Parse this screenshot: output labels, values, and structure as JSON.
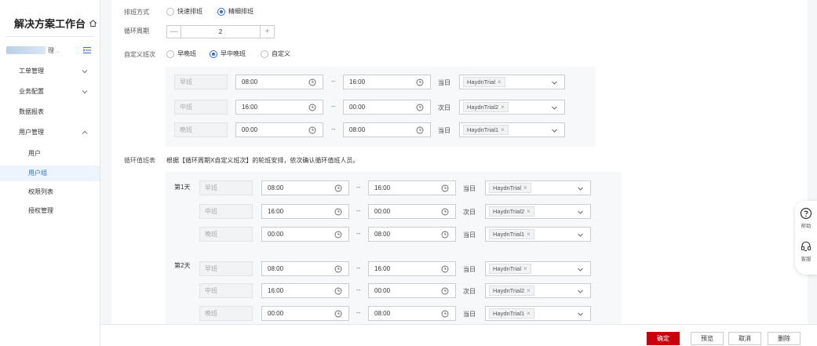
{
  "sidebar": {
    "title": "解决方案工作台",
    "user_text": "理",
    "user_dots": "..",
    "menus": [
      {
        "label": "工单管理",
        "state": "collapsed"
      },
      {
        "label": "业务配置",
        "state": "collapsed"
      },
      {
        "label": "数据报表"
      },
      {
        "label": "用户管理",
        "state": "expanded"
      }
    ],
    "submenu": [
      "用户",
      "用户组",
      "权限列表",
      "授权管理"
    ],
    "active": "用户组"
  },
  "form": {
    "schedule_mode": {
      "label": "排班方式",
      "options": [
        "快速排班",
        "精细排班"
      ],
      "selected": "精细排班"
    },
    "cycle_period": {
      "label": "循环周期",
      "value": "2",
      "minus": "—",
      "plus": "+"
    },
    "custom_shift": {
      "label": "自定义班次",
      "options": [
        "早晚班",
        "早中晚班",
        "自定义"
      ],
      "selected": "早中晚班"
    },
    "shifts": [
      {
        "name": "早班",
        "start": "08:00",
        "end": "16:00",
        "day": "当日",
        "person": "HaydnTrial"
      },
      {
        "name": "中班",
        "start": "16:00",
        "end": "00:00",
        "day": "次日",
        "person": "HaydnTrial2"
      },
      {
        "name": "晚班",
        "start": "00:00",
        "end": "08:00",
        "day": "当日",
        "person": "HaydnTrial1"
      }
    ],
    "separator": "--",
    "rotation_table": {
      "label": "循环值班表",
      "description": "根据【循环周期X自定义班次】的轮班安排，依次确认循环值班人员。",
      "days": [
        {
          "day_label": "第1天",
          "rows": [
            {
              "name": "早班",
              "start": "08:00",
              "end": "16:00",
              "day": "当日",
              "person": "HaydnTrial"
            },
            {
              "name": "中班",
              "start": "16:00",
              "end": "00:00",
              "day": "次日",
              "person": "HaydnTrial2"
            },
            {
              "name": "晚班",
              "start": "00:00",
              "end": "08:00",
              "day": "当日",
              "person": "HaydnTrial1"
            }
          ]
        },
        {
          "day_label": "第2天",
          "rows": [
            {
              "name": "早班",
              "start": "08:00",
              "end": "16:00",
              "day": "当日",
              "person": "HaydnTrial"
            },
            {
              "name": "中班",
              "start": "16:00",
              "end": "00:00",
              "day": "次日",
              "person": "HaydnTrial2"
            },
            {
              "name": "晚班",
              "start": "00:00",
              "end": "08:00",
              "day": "当日",
              "person": "HaydnTrial1"
            }
          ]
        }
      ]
    }
  },
  "float": {
    "help": "帮助",
    "service": "客服"
  },
  "footer": {
    "confirm": "确定",
    "preview": "预览",
    "cancel": "取消",
    "delete": "删除"
  },
  "colors": {
    "primary": "#c7000b",
    "accent": "#2f6fd8"
  },
  "icons": [
    "house-icon",
    "collapse-icon",
    "chevron-down-icon",
    "chevron-up-icon",
    "clock-icon",
    "question-icon",
    "headset-icon"
  ]
}
